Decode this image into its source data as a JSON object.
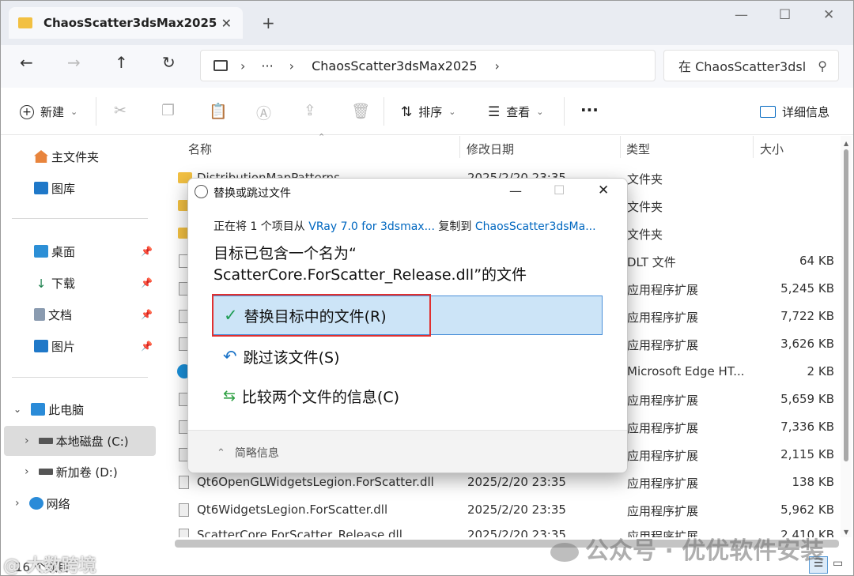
{
  "tab": {
    "title": "ChaosScatter3dsMax2025"
  },
  "window_controls": {
    "minimize": "—",
    "maximize": "☐",
    "close": "✕"
  },
  "nav": {
    "path_ellipsis": "···",
    "path_folder": "ChaosScatter3dsMax2025",
    "search_placeholder": "在 ChaosScatter3dsl"
  },
  "toolbar": {
    "new_label": "新建",
    "sort_label": "排序",
    "view_label": "查看",
    "more_label": "···",
    "details_label": "详细信息"
  },
  "sidebar": {
    "home": "主文件夹",
    "gallery": "图库",
    "desktop": "桌面",
    "downloads": "下载",
    "documents": "文档",
    "pictures": "图片",
    "this_pc": "此电脑",
    "local_disk": "本地磁盘 (C:)",
    "new_volume": "新加卷 (D:)",
    "network": "网络"
  },
  "columns": {
    "name": "名称",
    "date": "修改日期",
    "type": "类型",
    "size": "大小"
  },
  "rows": [
    {
      "name": "DistributionMapPatterns",
      "date": "2025/2/20 23:35",
      "type": "文件夹",
      "size": ""
    },
    {
      "name": "",
      "date": "",
      "type": "文件夹",
      "size": ""
    },
    {
      "name": "",
      "date": "",
      "type": "文件夹",
      "size": ""
    },
    {
      "name": "",
      "date": "",
      "type": "DLT 文件",
      "size": "64 KB"
    },
    {
      "name": "",
      "date": "",
      "type": "应用程序扩展",
      "size": "5,245 KB"
    },
    {
      "name": "",
      "date": "",
      "type": "应用程序扩展",
      "size": "7,722 KB"
    },
    {
      "name": "",
      "date": "",
      "type": "应用程序扩展",
      "size": "3,626 KB"
    },
    {
      "name": "",
      "date": "",
      "type": "Microsoft Edge HT...",
      "size": "2 KB"
    },
    {
      "name": "",
      "date": "",
      "type": "应用程序扩展",
      "size": "5,659 KB"
    },
    {
      "name": "",
      "date": "",
      "type": "应用程序扩展",
      "size": "7,336 KB"
    },
    {
      "name": "",
      "date": "",
      "type": "应用程序扩展",
      "size": "2,115 KB"
    },
    {
      "name": "Qt6OpenGLWidgetsLegion.ForScatter.dll",
      "date": "2025/2/20 23:35",
      "type": "应用程序扩展",
      "size": "138 KB"
    },
    {
      "name": "Qt6WidgetsLegion.ForScatter.dll",
      "date": "2025/2/20 23:35",
      "type": "应用程序扩展",
      "size": "5,962 KB"
    },
    {
      "name": "ScatterCore.ForScatter_Release.dll",
      "date": "2025/2/20 23:35",
      "type": "应用程序扩展",
      "size": "2,410 KB"
    }
  ],
  "status": {
    "count": "16 个项目"
  },
  "dialog": {
    "title": "替换或跳过文件",
    "line1_prefix": "正在将 1 个项目从 ",
    "line1_source": "VRay 7.0 for 3dsmax...",
    "line1_mid": " 复制到 ",
    "line1_dest": "ChaosScatter3dsMa...",
    "heading_line1": "目标已包含一个名为“",
    "heading_line2": "ScatterCore.ForScatter_Release.dll”的文件",
    "option_replace": "替换目标中的文件(R)",
    "option_skip": "跳过该文件(S)",
    "option_compare": "比较两个文件的信息(C)",
    "details": "简略信息"
  },
  "watermarks": {
    "bottom_right": "公众号 · 优优软件安装",
    "bottom_left": "@ 大数跨境"
  },
  "colors": {
    "accent": "#0067c0",
    "highlight": "#cce4f7",
    "highlight_border": "#4a90d9",
    "red_box": "#e03030"
  }
}
